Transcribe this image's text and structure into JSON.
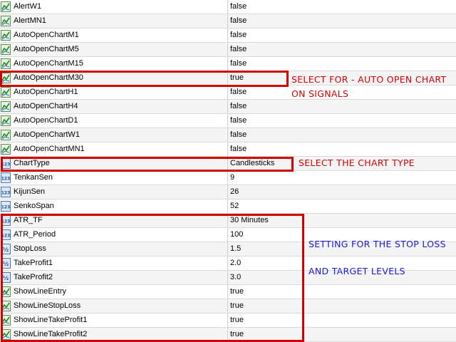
{
  "colors": {
    "annotation_red": "#d40000",
    "annotation_blue": "#1a1ad6"
  },
  "rows": [
    {
      "name": "AlertW1",
      "value": "false",
      "icon": "bool-toggle-icon"
    },
    {
      "name": "AlertMN1",
      "value": "false",
      "icon": "bool-toggle-icon"
    },
    {
      "name": "AutoOpenChartM1",
      "value": "false",
      "icon": "bool-toggle-icon"
    },
    {
      "name": "AutoOpenChartM5",
      "value": "false",
      "icon": "bool-toggle-icon"
    },
    {
      "name": "AutoOpenChartM15",
      "value": "false",
      "icon": "bool-toggle-icon"
    },
    {
      "name": "AutoOpenChartM30",
      "value": "true",
      "icon": "bool-toggle-icon"
    },
    {
      "name": "AutoOpenChartH1",
      "value": "false",
      "icon": "bool-toggle-icon"
    },
    {
      "name": "AutoOpenChartH4",
      "value": "false",
      "icon": "bool-toggle-icon"
    },
    {
      "name": "AutoOpenChartD1",
      "value": "false",
      "icon": "bool-toggle-icon"
    },
    {
      "name": "AutoOpenChartW1",
      "value": "false",
      "icon": "bool-toggle-icon"
    },
    {
      "name": "AutoOpenChartMN1",
      "value": "false",
      "icon": "bool-toggle-icon"
    },
    {
      "name": "ChartType",
      "value": "Candlesticks",
      "icon": "integer-123-icon"
    },
    {
      "name": "TenkanSen",
      "value": "9",
      "icon": "integer-123-icon"
    },
    {
      "name": "KijunSen",
      "value": "26",
      "icon": "integer-123-icon"
    },
    {
      "name": "SenkoSpan",
      "value": "52",
      "icon": "integer-123-icon"
    },
    {
      "name": "ATR_TF",
      "value": "30 Minutes",
      "icon": "integer-123-icon"
    },
    {
      "name": "ATR_Period",
      "value": "100",
      "icon": "integer-123-icon"
    },
    {
      "name": "StopLoss",
      "value": "1.5",
      "icon": "double-value-icon"
    },
    {
      "name": "TakeProfit1",
      "value": "2.0",
      "icon": "double-value-icon"
    },
    {
      "name": "TakeProfit2",
      "value": "3.0",
      "icon": "double-value-icon"
    },
    {
      "name": "ShowLineEntry",
      "value": "true",
      "icon": "bool-toggle-icon"
    },
    {
      "name": "ShowLineStopLoss",
      "value": "true",
      "icon": "bool-toggle-icon"
    },
    {
      "name": "ShowLineTakeProfit1",
      "value": "true",
      "icon": "bool-toggle-icon"
    },
    {
      "name": "ShowLineTakeProfit2",
      "value": "true",
      "icon": "bool-toggle-icon"
    }
  ],
  "annotations": {
    "auto_open_line1": "SELECT FOR - AUTO OPEN CHART",
    "auto_open_line2": "ON SIGNALS",
    "chart_type": "SELECT THE CHART TYPE",
    "stop_loss_line1": "SETTING FOR THE STOP LOSS",
    "stop_loss_line2": "AND TARGET LEVELS"
  }
}
